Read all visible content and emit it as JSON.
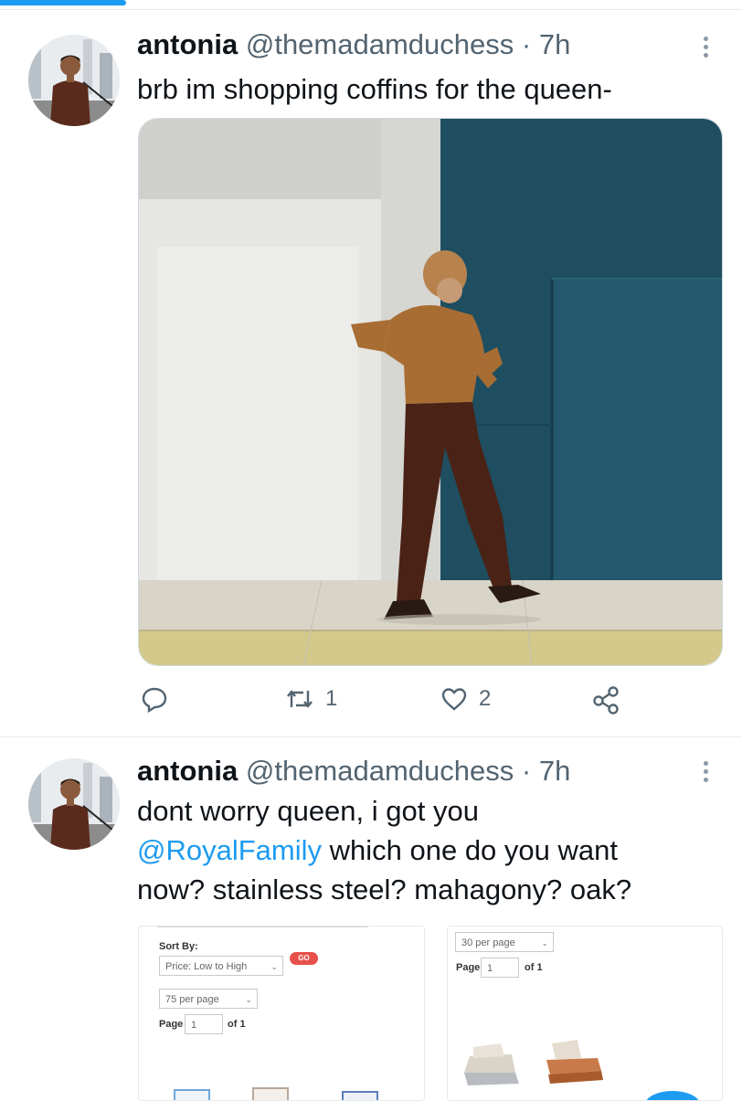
{
  "tweets": [
    {
      "display_name": "antonia",
      "handle": "@themadamduchess",
      "separator": "·",
      "time": "7h",
      "text": "brb im shopping coffins for the queen-",
      "actions": {
        "retweets": "1",
        "likes": "2"
      }
    },
    {
      "display_name": "antonia",
      "handle": "@themadamduchess",
      "separator": "·",
      "time": "7h",
      "text_line1": "dont worry queen, i got you",
      "mention": "@RoyalFamily",
      "text_line2_rest": " which one do you want",
      "text_line3": "now? stainless steel? mahagony? oak?",
      "media_left": {
        "sort_by_label": "Sort By:",
        "sort_value": "Price: Low to High",
        "go_label": "GO",
        "per_page_value": "75 per page",
        "page_label": "Page",
        "page_value": "1",
        "of_label": "of 1"
      },
      "media_right": {
        "per_page_value": "30 per page",
        "page_label": "Page",
        "page_value": "1",
        "of_label": "of 1"
      }
    }
  ],
  "colors": {
    "accent": "#1d9bf0",
    "secondary_text": "#536471",
    "go_button": "#e8504a"
  },
  "icons": [
    "reply-icon",
    "retweet-icon",
    "like-icon",
    "share-icon",
    "more-icon"
  ]
}
